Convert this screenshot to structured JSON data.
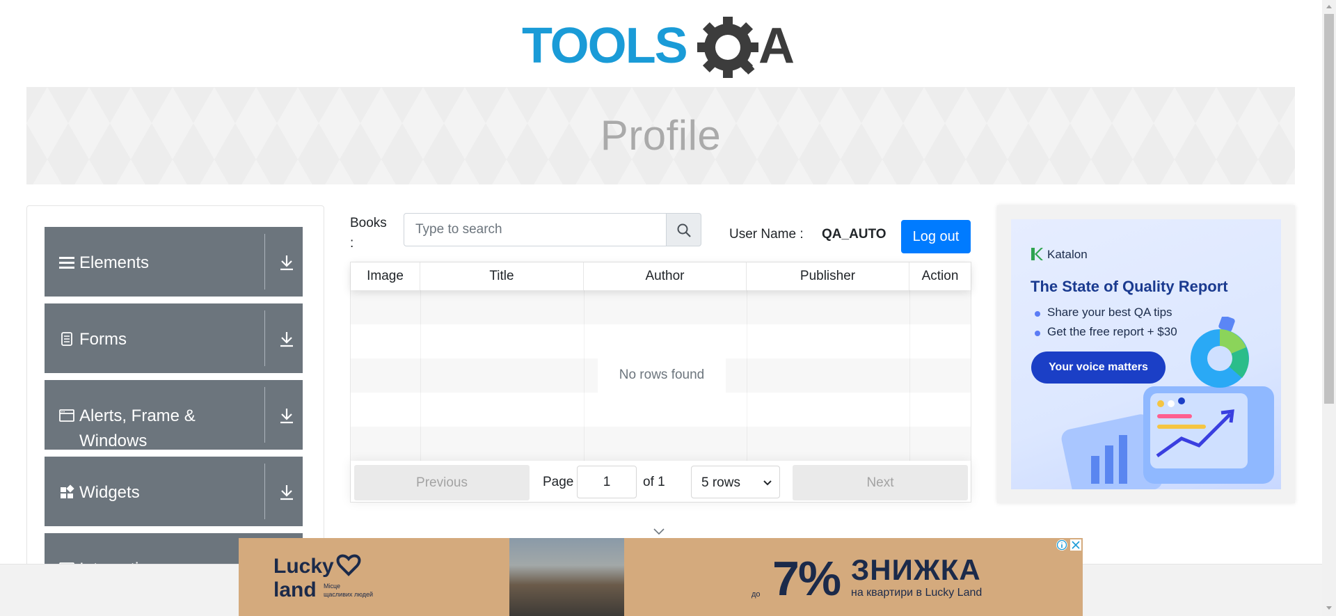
{
  "header": {
    "logo_text": "TOOLSQA"
  },
  "banner": {
    "title": "Profile"
  },
  "sidebar": {
    "groups": [
      {
        "label": "Elements",
        "icon": "menu-icon"
      },
      {
        "label": "Forms",
        "icon": "document-icon"
      },
      {
        "label": "Alerts, Frame & Windows",
        "icon": "window-icon"
      },
      {
        "label": "Widgets",
        "icon": "widgets-icon"
      },
      {
        "label": "Interactions",
        "icon": "interactions-icon"
      }
    ]
  },
  "books": {
    "label": "Books :",
    "search_placeholder": "Type to search",
    "user_label": "User Name :",
    "user_value": "QA_AUTO",
    "logout_label": "Log out"
  },
  "table": {
    "columns": [
      "Image",
      "Title",
      "Author",
      "Publisher",
      "Action"
    ],
    "rows": [],
    "empty_text": "No rows found",
    "pagination": {
      "previous_label": "Previous",
      "page_label": "Page",
      "page_value": "1",
      "of_label": "of 1",
      "rows_option": "5 rows",
      "next_label": "Next"
    }
  },
  "right_ad": {
    "brand": "Katalon",
    "title": "The State of Quality Report",
    "bullets": [
      "Share your best QA tips",
      "Get the free report + $30"
    ],
    "cta": "Your voice matters"
  },
  "bottom_ad": {
    "brand": "Lucky land",
    "brand_tagline": "Місце щасливих людей",
    "prefix": "до",
    "percent": "7%",
    "headline": "ЗНИЖКА",
    "subline": "на квартири в Lucky Land"
  },
  "colors": {
    "primary": "#007bff",
    "sidebar_group": "#6c757d",
    "logo_blue": "#1a9bd7",
    "logo_dark": "#3c3c3c"
  }
}
